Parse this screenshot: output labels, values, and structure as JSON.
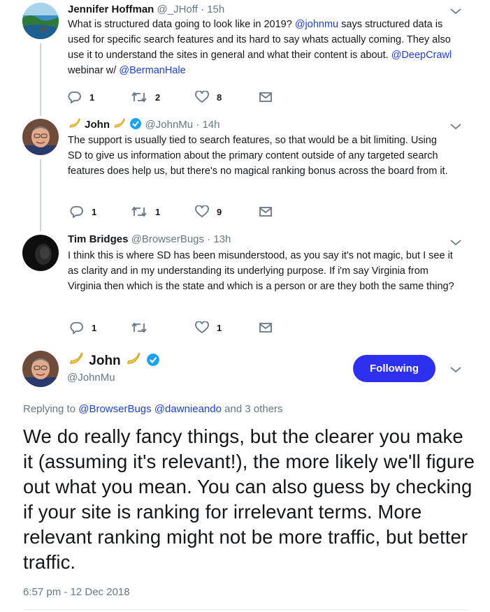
{
  "tweets": [
    {
      "name": "Jennifer Hoffman",
      "handle": "@_JHoff",
      "time": "15h",
      "text_before": "What is structured data going to look like in 2019? ",
      "mention1": "@johnmu",
      "text_middle": " says structured data is used for specific search features and its hard to say whats actually coming. They also use it to understand the sites in general and what their content is about. ",
      "mention2": "@DeepCrawl",
      "text_after": " webinar w/ ",
      "mention3": "@BermanHale",
      "replies": "1",
      "retweets": "2",
      "likes": "8"
    },
    {
      "name": "John",
      "handle": "@JohnMu",
      "time": "14h",
      "text": "The support is usually tied to search features, so that would be a bit limiting. Using SD to give us information about the primary content outside of any targeted search features does help us, but there's no magical ranking bonus across the board from it.",
      "replies": "1",
      "retweets": "1",
      "likes": "9"
    },
    {
      "name": "Tim Bridges",
      "handle": "@BrowserBugs",
      "time": "13h",
      "text": "I think this is where SD has been misunderstood, as you say it's not magic, but I see it as clarity and in my understanding its underlying purpose. If i'm say Virginia from Virginia then which is the state and which is a person or are they both the same thing?",
      "replies": "1",
      "retweets": "",
      "likes": "1"
    }
  ],
  "main": {
    "name": "John",
    "handle": "@JohnMu",
    "follow_label": "Following",
    "replying_prefix": "Replying to ",
    "replying_user1": "@BrowserBugs",
    "replying_user2": "@dawnieando",
    "replying_suffix": " and 3 others",
    "text": "We do really fancy things, but the clearer you make it (assuming it's relevant!), the more likely we'll figure out what you mean. You can also guess by checking if your site is ranking for irrelevant terms. More relevant ranking might not be more traffic, but better traffic.",
    "timestamp": "6:57 pm - 12 Dec 2018"
  },
  "colors": {
    "link": "#1b3fcf",
    "follow_button": "#2d31ef",
    "muted": "#657786",
    "verified": "#1da1f2"
  },
  "icons": [
    "reply-icon",
    "retweet-icon",
    "like-icon",
    "direct-message-icon",
    "chevron-down-icon",
    "verified-icon",
    "banana-icon"
  ]
}
